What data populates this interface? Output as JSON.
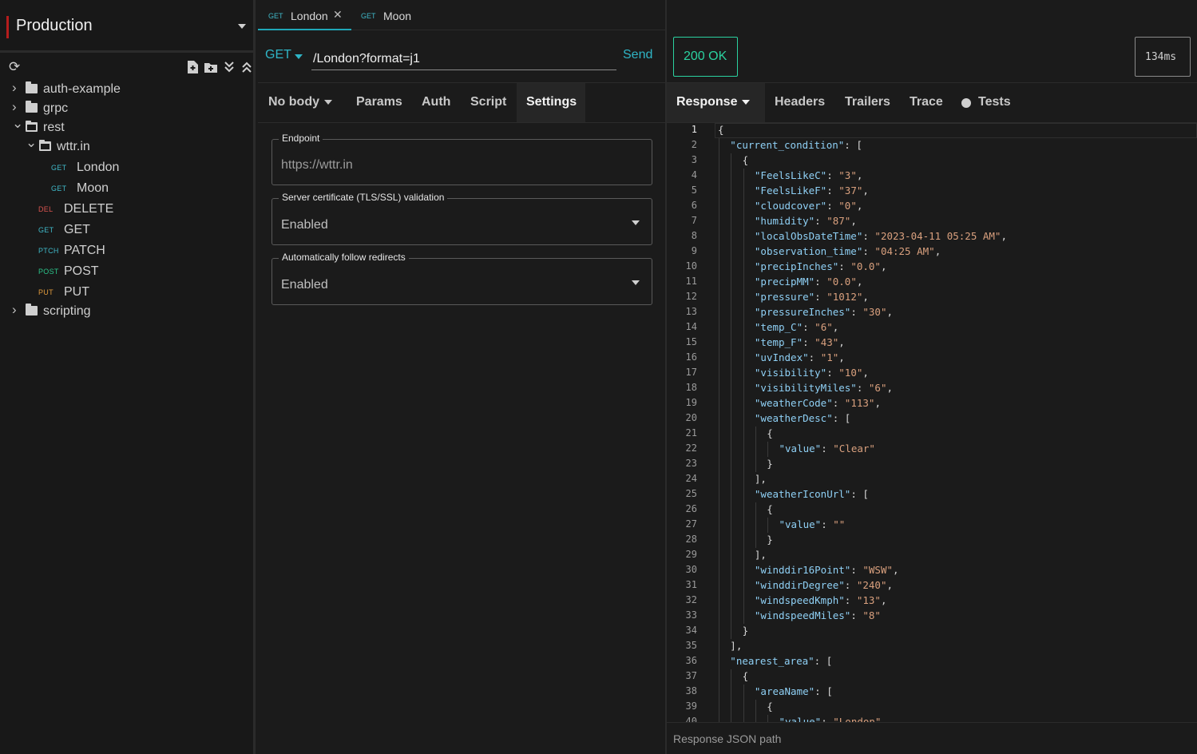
{
  "sidebar": {
    "environment": "Production",
    "tree": [
      {
        "type": "folder",
        "label": "auth-example",
        "depth": 0,
        "open": false
      },
      {
        "type": "folder",
        "label": "grpc",
        "depth": 0,
        "open": false
      },
      {
        "type": "folder",
        "label": "rest",
        "depth": 0,
        "open": true
      },
      {
        "type": "folder",
        "label": "wttr.in",
        "depth": 1,
        "open": true
      },
      {
        "type": "request",
        "method": "GET",
        "label": "London",
        "depth": 2
      },
      {
        "type": "request",
        "method": "GET",
        "label": "Moon",
        "depth": 2
      },
      {
        "type": "request",
        "method": "DEL",
        "label": "DELETE",
        "depth": 1
      },
      {
        "type": "request",
        "method": "GET",
        "label": "GET",
        "depth": 1
      },
      {
        "type": "request",
        "method": "PTCH",
        "label": "PATCH",
        "depth": 1
      },
      {
        "type": "request",
        "method": "POST",
        "label": "POST",
        "depth": 1
      },
      {
        "type": "request",
        "method": "PUT",
        "label": "PUT",
        "depth": 1
      },
      {
        "type": "folder",
        "label": "scripting",
        "depth": 0,
        "open": false
      }
    ]
  },
  "method_colors": {
    "GET": "#3fb8c8",
    "DEL": "#d9534f",
    "PTCH": "#3fb8c8",
    "POST": "#2bc48a",
    "PUT": "#e09a3c"
  },
  "tabs": [
    {
      "method": "GET",
      "label": "London",
      "active": true,
      "closable": true
    },
    {
      "method": "GET",
      "label": "Moon",
      "active": false,
      "closable": false
    }
  ],
  "request": {
    "method": "GET",
    "url": "/London?format=j1",
    "send_label": "Send",
    "tabs": [
      {
        "label": "No body",
        "dropdown": true,
        "active": false
      },
      {
        "label": "Params",
        "active": false
      },
      {
        "label": "Auth",
        "active": false
      },
      {
        "label": "Script",
        "active": false
      },
      {
        "label": "Settings",
        "active": true
      }
    ],
    "settings": {
      "endpoint_label": "Endpoint",
      "endpoint_placeholder": "https://wttr.in",
      "tls_label": "Server certificate (TLS/SSL) validation",
      "tls_value": "Enabled",
      "redirect_label": "Automatically follow redirects",
      "redirect_value": "Enabled"
    }
  },
  "response": {
    "status": "200 OK",
    "time": "134ms",
    "tabs": [
      {
        "label": "Response",
        "dropdown": true,
        "active": true
      },
      {
        "label": "Headers"
      },
      {
        "label": "Trailers"
      },
      {
        "label": "Trace"
      },
      {
        "label": "Tests",
        "dot": true
      }
    ],
    "json_path_placeholder": "Response JSON path",
    "code_lines": [
      [
        0,
        "{"
      ],
      [
        1,
        "\"current_condition\": ["
      ],
      [
        2,
        "{"
      ],
      [
        3,
        "\"FeelsLikeC\": \"3\","
      ],
      [
        3,
        "\"FeelsLikeF\": \"37\","
      ],
      [
        3,
        "\"cloudcover\": \"0\","
      ],
      [
        3,
        "\"humidity\": \"87\","
      ],
      [
        3,
        "\"localObsDateTime\": \"2023-04-11 05:25 AM\","
      ],
      [
        3,
        "\"observation_time\": \"04:25 AM\","
      ],
      [
        3,
        "\"precipInches\": \"0.0\","
      ],
      [
        3,
        "\"precipMM\": \"0.0\","
      ],
      [
        3,
        "\"pressure\": \"1012\","
      ],
      [
        3,
        "\"pressureInches\": \"30\","
      ],
      [
        3,
        "\"temp_C\": \"6\","
      ],
      [
        3,
        "\"temp_F\": \"43\","
      ],
      [
        3,
        "\"uvIndex\": \"1\","
      ],
      [
        3,
        "\"visibility\": \"10\","
      ],
      [
        3,
        "\"visibilityMiles\": \"6\","
      ],
      [
        3,
        "\"weatherCode\": \"113\","
      ],
      [
        3,
        "\"weatherDesc\": ["
      ],
      [
        4,
        "{"
      ],
      [
        5,
        "\"value\": \"Clear\""
      ],
      [
        4,
        "}"
      ],
      [
        3,
        "],"
      ],
      [
        3,
        "\"weatherIconUrl\": ["
      ],
      [
        4,
        "{"
      ],
      [
        5,
        "\"value\": \"\""
      ],
      [
        4,
        "}"
      ],
      [
        3,
        "],"
      ],
      [
        3,
        "\"winddir16Point\": \"WSW\","
      ],
      [
        3,
        "\"winddirDegree\": \"240\","
      ],
      [
        3,
        "\"windspeedKmph\": \"13\","
      ],
      [
        3,
        "\"windspeedMiles\": \"8\""
      ],
      [
        2,
        "}"
      ],
      [
        1,
        "],"
      ],
      [
        1,
        "\"nearest_area\": ["
      ],
      [
        2,
        "{"
      ],
      [
        3,
        "\"areaName\": ["
      ],
      [
        4,
        "{"
      ],
      [
        5,
        "\"value\": \"London\""
      ]
    ]
  }
}
